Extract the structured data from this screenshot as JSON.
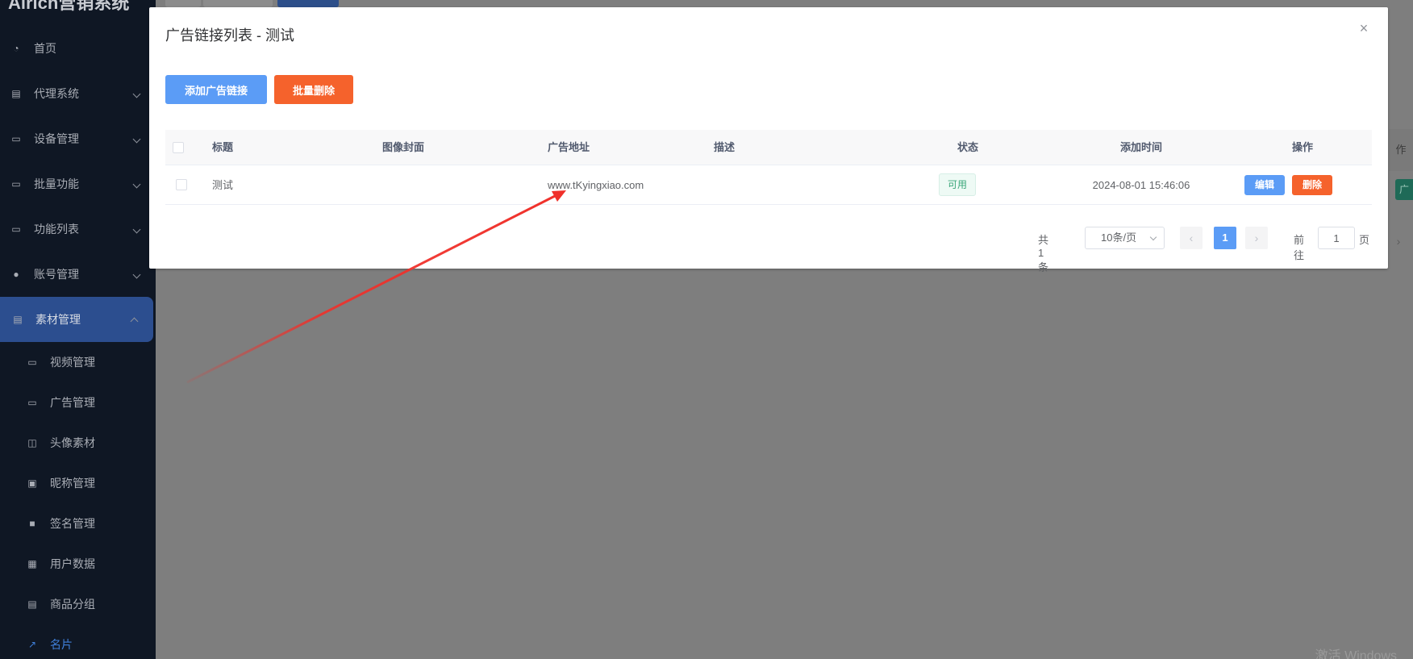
{
  "sidebar": {
    "brand": "Airich营销系统",
    "items": [
      {
        "label": "首页",
        "icon": "dashboard-icon"
      },
      {
        "label": "代理系统",
        "icon": "document-icon"
      },
      {
        "label": "设备管理",
        "icon": "monitor-icon"
      },
      {
        "label": "批量功能",
        "icon": "monitor-icon"
      },
      {
        "label": "功能列表",
        "icon": "monitor-icon"
      },
      {
        "label": "账号管理",
        "icon": "user-icon"
      },
      {
        "label": "素材管理",
        "icon": "document-icon"
      }
    ],
    "sub_items": [
      {
        "label": "视频管理",
        "icon": "monitor-icon"
      },
      {
        "label": "广告管理",
        "icon": "monitor-icon"
      },
      {
        "label": "头像素材",
        "icon": "book-icon"
      },
      {
        "label": "昵称管理",
        "icon": "id-icon"
      },
      {
        "label": "签名管理",
        "icon": "text-icon"
      },
      {
        "label": "用户数据",
        "icon": "grid-icon"
      },
      {
        "label": "商品分组",
        "icon": "list-icon"
      },
      {
        "label": "名片",
        "icon": "external-link-icon"
      }
    ]
  },
  "background": {
    "table_header_fragment": "作",
    "green_button_fragment": "广",
    "watermark": "激活 Windows"
  },
  "dialog": {
    "title": "广告链接列表 - 测试",
    "add_button": "添加广告链接",
    "batch_delete_button": "批量删除",
    "columns": [
      "标题",
      "图像封面",
      "广告地址",
      "描述",
      "状态",
      "添加时间",
      "操作"
    ],
    "rows": [
      {
        "title": "测试",
        "cover": "",
        "url": "www.tKyingxiao.com",
        "description": "",
        "status": "可用",
        "added_time": "2024-08-01 15:46:06",
        "edit_label": "编辑",
        "delete_label": "删除"
      }
    ],
    "pagination": {
      "total": "共 1 条",
      "page_size": "10条/页",
      "current_page": "1",
      "goto_prefix": "前往",
      "goto_value": "1",
      "goto_suffix": "页"
    }
  },
  "colors": {
    "primary": "#5b9cf6",
    "danger": "#f5622c",
    "success": "#3ca77a",
    "sidebar_bg": "#0f1724",
    "sidebar_active": "#2c4e8f",
    "annotation_arrow": "#f0302a"
  }
}
